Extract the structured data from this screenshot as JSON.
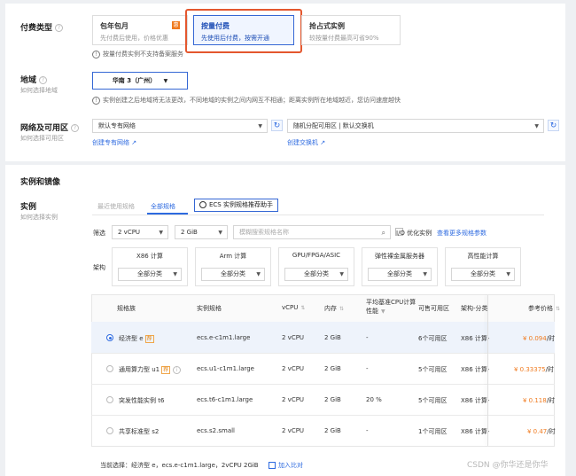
{
  "billing": {
    "label": "付费类型",
    "options": [
      {
        "title": "包年包月",
        "desc": "先付费后使用，价格优惠",
        "badge": "惠"
      },
      {
        "title": "按量付费",
        "desc": "先使用后付费，按需开通"
      },
      {
        "title": "抢占式实例",
        "desc": "较按量付费最高可省90%"
      }
    ],
    "note": "按量付费实例不支持备案服务"
  },
  "region": {
    "label": "地域",
    "help": "如何选择地域",
    "value": "华南 3（广州）",
    "note": "实例创建之后地域将无法更改，不同地域的实例之间内网互不相通；距离实例所在地域越近，您访问速度越快"
  },
  "network": {
    "label": "网络及可用区",
    "help": "如何选择可用区",
    "vpc": "默认专有网络",
    "zone": "随机分配可用区 | 默认交换机",
    "create_vpc": "创建专有网络",
    "create_switch": "创建交换机"
  },
  "section2": {
    "title": "实例和镜像",
    "instance_label": "实例",
    "instance_help": "如何选择实例",
    "tabs": [
      "最近使用规格",
      "全部规格"
    ],
    "assistant": "ECS 实例规格推荐助手"
  },
  "filter": {
    "label": "筛选",
    "vcpu": "2 vCPU",
    "mem": "2 GiB",
    "search_placeholder": "模糊搜索规格名称",
    "io_label": "I/O 优化实例",
    "more_link": "查看更多规格参数"
  },
  "arch": {
    "label": "架构",
    "cols": [
      "X86 计算",
      "Arm 计算",
      "GPU/FPGA/ASIC",
      "弹性裸金属服务器",
      "高性能计算"
    ],
    "all": "全部分类"
  },
  "table": {
    "headers": {
      "family": "规格族",
      "spec": "实例规格",
      "vcpu": "vCPU",
      "mem": "内存",
      "baseline": "平均基准CPU计算性能",
      "zone": "可售可用区",
      "arch": "架构-分类",
      "price": "参考价格"
    },
    "rows": [
      {
        "family": "经济型 e",
        "tag": "荐",
        "spec": "ecs.e-c1m1.large",
        "vcpu": "2 vCPU",
        "mem": "2 GiB",
        "baseline": "-",
        "zone": "6个可用区",
        "arch": "X86 计算-",
        "price": "¥ 0.094",
        "unit": "/时",
        "selected": true
      },
      {
        "family": "通用算力型 u1",
        "tag": "荐",
        "spec": "ecs.u1-c1m1.large",
        "vcpu": "2 vCPU",
        "mem": "2 GiB",
        "baseline": "-",
        "zone": "5个可用区",
        "arch": "X86 计算-",
        "price": "¥ 0.33375",
        "unit": "/时",
        "selected": false
      },
      {
        "family": "突发性能实例 t6",
        "tag": "",
        "spec": "ecs.t6-c1m1.large",
        "vcpu": "2 vCPU",
        "mem": "2 GiB",
        "baseline": "20 %",
        "zone": "5个可用区",
        "arch": "X86 计算-",
        "price": "¥ 0.118",
        "unit": "/时",
        "selected": false
      },
      {
        "family": "共享标准型 s2",
        "tag": "",
        "spec": "ecs.s2.small",
        "vcpu": "2 vCPU",
        "mem": "2 GiB",
        "baseline": "-",
        "zone": "1个可用区",
        "arch": "X86 计算-",
        "price": "¥ 0.47",
        "unit": "/时",
        "selected": false
      }
    ]
  },
  "footer": {
    "current": "当前选择：经济型 e，ecs.e-c1m1.large，2vCPU 2GiB",
    "compare": "加入比对"
  },
  "watermark": "CSDN @你华还是你华"
}
